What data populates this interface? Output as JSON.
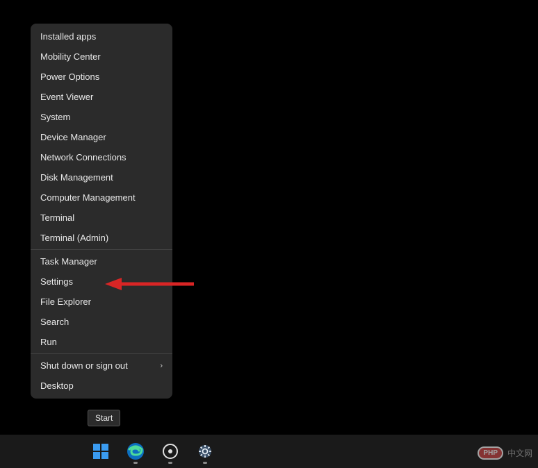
{
  "menu": {
    "items": [
      {
        "label": "Installed apps"
      },
      {
        "label": "Mobility Center"
      },
      {
        "label": "Power Options"
      },
      {
        "label": "Event Viewer"
      },
      {
        "label": "System"
      },
      {
        "label": "Device Manager"
      },
      {
        "label": "Network Connections"
      },
      {
        "label": "Disk Management"
      },
      {
        "label": "Computer Management"
      },
      {
        "label": "Terminal"
      },
      {
        "label": "Terminal (Admin)"
      }
    ],
    "items2": [
      {
        "label": "Task Manager"
      },
      {
        "label": "Settings"
      },
      {
        "label": "File Explorer"
      },
      {
        "label": "Search"
      },
      {
        "label": "Run"
      }
    ],
    "items3": [
      {
        "label": "Shut down or sign out",
        "hasSubmenu": true
      },
      {
        "label": "Desktop"
      }
    ]
  },
  "tooltip": {
    "text": "Start"
  },
  "watermark": {
    "badge": "PHP",
    "text": "中文网"
  },
  "colors": {
    "menuBg": "#2b2b2b",
    "text": "#e8e8e8",
    "arrow": "#d92525"
  }
}
